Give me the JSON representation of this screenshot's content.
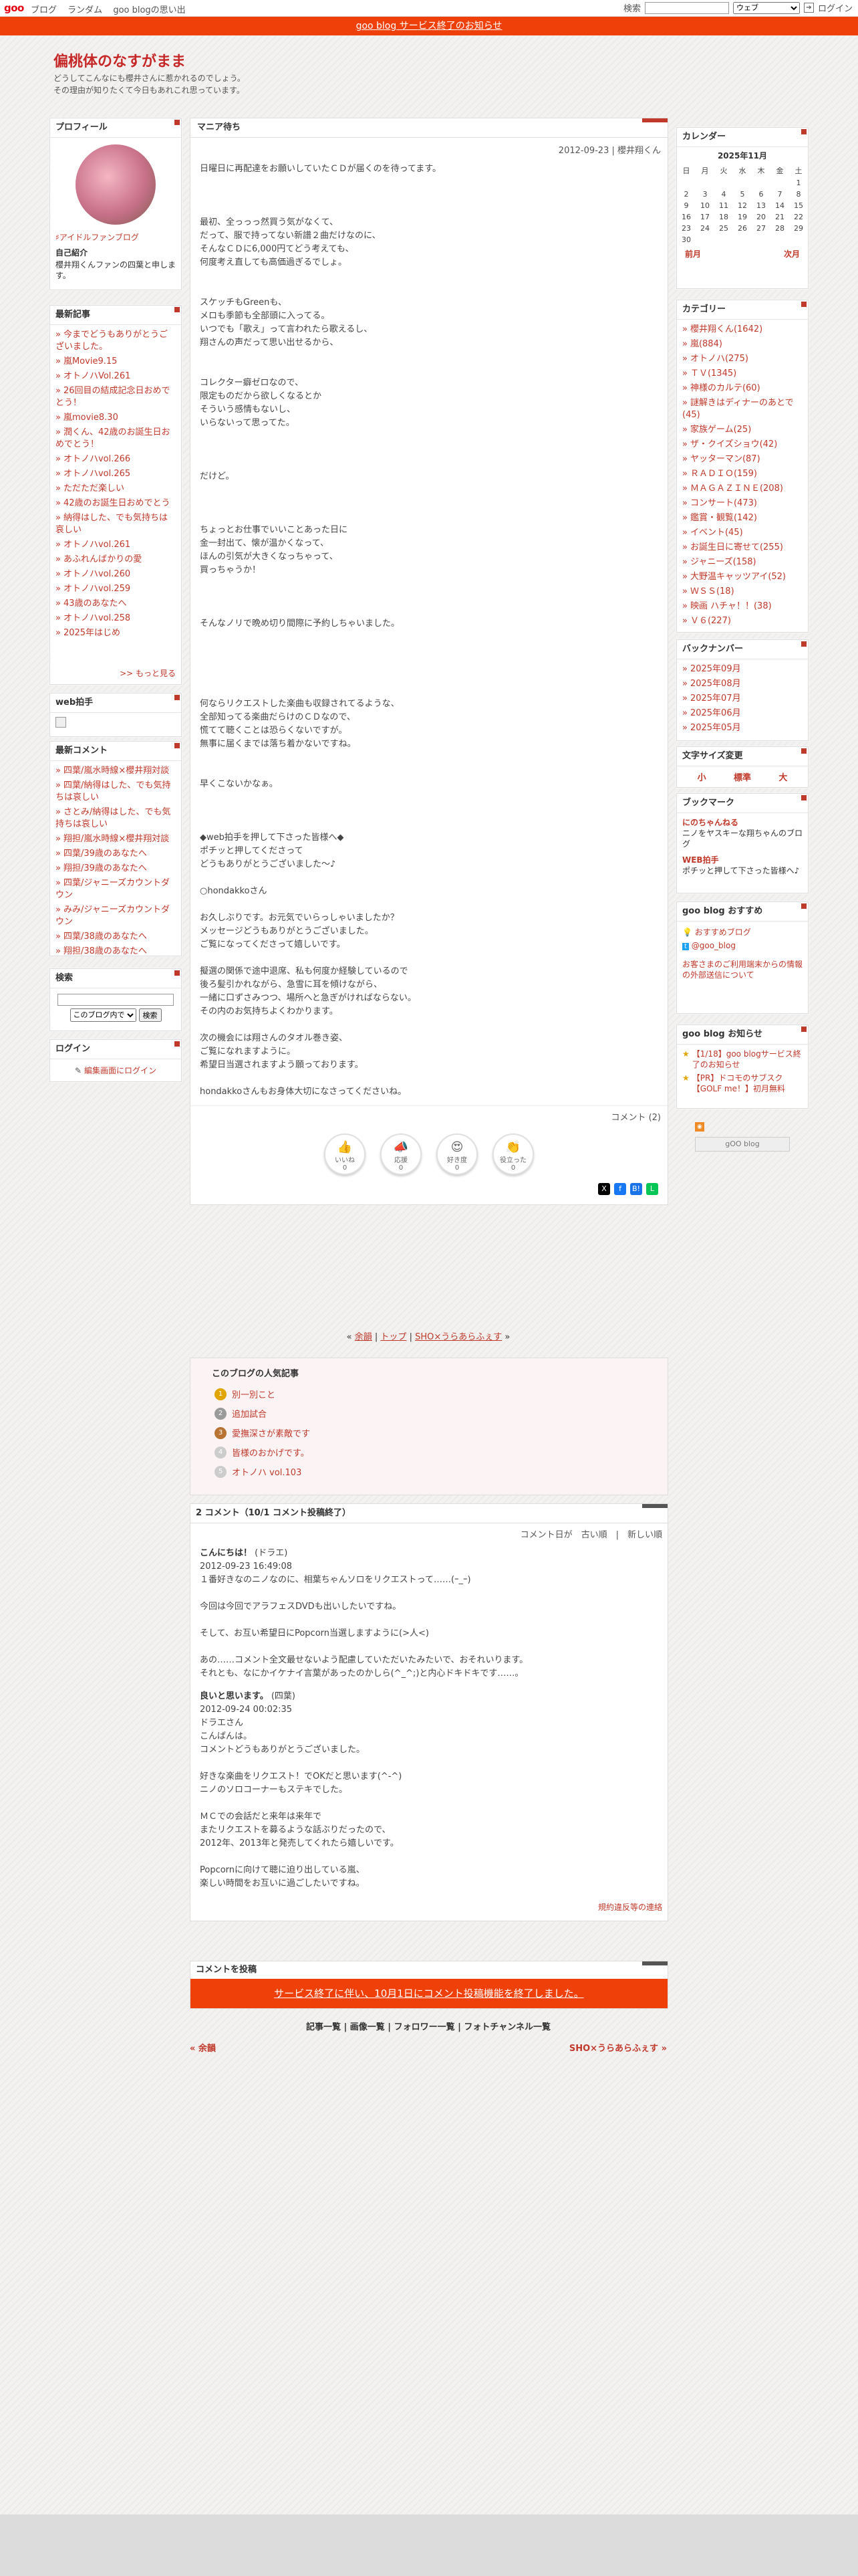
{
  "topbar": {
    "logo": "goo",
    "nav": [
      "ブログ",
      "ランダム",
      "goo blogの思い出"
    ],
    "search_label": "検索",
    "scope": "ウェブ",
    "login": "ログイン"
  },
  "notice": "goo blog サービス終了のお知らせ",
  "blog": {
    "title": "偏桃体のなすがまま",
    "desc1": "どうしてこんなにも櫻井さんに惹かれるのでしょう。",
    "desc2": "その理由が知りたくて今日もあれこれ思っています。"
  },
  "profile": {
    "heading": "プロフィール",
    "badge": "♯アイドルファンブログ",
    "intro_label": "自己紹介",
    "intro": "櫻井翔くんファンの四葉と申します。"
  },
  "recent": {
    "heading": "最新記事",
    "items": [
      "今までどうもありがとうございました。",
      "嵐Movie9.15",
      "オトノハVol.261",
      "26回目の結成記念日おめでとう！",
      "嵐movie8.30",
      "潤くん、42歳のお誕生日おめでとう！",
      "オトノハvol.266",
      "オトノハvol.265",
      "ただただ楽しい",
      "42歳のお誕生日おめでとう",
      "納得はした、でも気持ちは哀しい",
      "オトノハvol.261",
      "あふれんばかりの愛",
      "オトノハvol.260",
      "オトノハvol.259",
      "43歳のあなたへ",
      "オトノハvol.258",
      "2025年はじめ"
    ],
    "more": ">> もっと見る"
  },
  "webclap": {
    "heading": "web拍手"
  },
  "recent_comments": {
    "heading": "最新コメント",
    "items": [
      "四葉/嵐水時線×櫻井翔対談",
      "四葉/納得はした、でも気持ちは哀しい",
      "さとみ/納得はした、でも気持ちは哀しい",
      "翔担/嵐水時線×櫻井翔対談",
      "四葉/39歳のあなたへ",
      "翔担/39歳のあなたへ",
      "四葉/ジャニーズカウントダウン",
      "みみ/ジャニーズカウントダウン",
      "四葉/38歳のあなたへ",
      "翔担/38歳のあなたへ"
    ]
  },
  "search": {
    "heading": "検索",
    "scope": "このブログ内で",
    "button": "検索"
  },
  "login": {
    "heading": "ログイン",
    "link": "編集画面にログイン"
  },
  "post": {
    "title": "マニア待ち",
    "date": "2012-09-23 | 櫻井翔くん",
    "body": "日曜日に再配達をお願いしていたＣＤが届くのを待ってます。\n\n\n\n最初、全っっっ然買う気がなくて、\nだって、服で持ってない新譜２曲だけなのに、\nそんなＣＤに6,000円てどう考えても、\n何度考え直しても高価過ぎるでしょ。\n\n\nスケッチもGreenも、\nメロも季節も全部頭に入ってる。\nいつでも「歌え」って言われたら歌えるし、\n翔さんの声だって思い出せるから、\n\n\nコレクター癖ゼロなので、\n限定ものだから欲しくなるとか\nそういう感情もないし、\nいらないって思ってた。\n\n\n\nだけど。\n\n\n\nちょっとお仕事でいいことあった日に\n金一封出て、懐が温かくなって、\nほんの引気が大きくなっちゃって、\n買っちゃうか！\n\n\n\nそんなノリで晩め切り間際に予約しちゃいました。\n\n\n\n\n\n何ならリクエストした楽曲も収録されてるような、\n全部知ってる楽曲だらけのＣＤなので、\n慌てて聴くことは恐らくないですが。\n無事に届くまでは落ち着かないですね。\n\n\n早くこないかなぁ。\n\n\n\n◆web拍手を押して下さった皆様へ◆\nポチッと押してくださって\nどうもありがとうございました～♪\n\n○hondakkoさん\n\nお久しぶりです。お元気でいらっしゃいましたか？\nメッセージどうもありがとうございました。\nご覧になってくださって嬉しいです。\n\n擬選の関係で途中退席、私も何度か経験しているので\n後ろ髪引かれながら、急雪に耳を傾けながら、\n一緒に口ずさみつつ、場所へと急ぎがければならない。\nその内のお気持ちよくわかります。\n\n次の機会には翔さんのタオル巻き姿、\nご覧になれますように。\n希望日当選されますよう願っております。\n\nhondakkoさんもお身体大切になさってくださいね。",
    "comment_link": "コメント (2)",
    "reactions": [
      {
        "label": "いいね",
        "count": "0"
      },
      {
        "label": "応援",
        "count": "0"
      },
      {
        "label": "好き度",
        "count": "0"
      },
      {
        "label": "役立った",
        "count": "0"
      }
    ]
  },
  "pager": {
    "prev": "余韻",
    "top": "トップ",
    "next": "SHO×うらあらふぇす"
  },
  "popular": {
    "heading": "このブログの人気記事",
    "items": [
      "別一別こと",
      "追加試合",
      "愛撫深さが素敵です",
      "皆様のおかげです。",
      "オトノハ vol.103"
    ]
  },
  "comments": {
    "heading": "2 コメント（10/1 コメント投稿終了）",
    "filter": "コメント日が　古い順　|　新しい順",
    "entries": [
      {
        "name": "こんにちは！",
        "author": "(ドラエ)",
        "date": "2012-09-23 16:49:08",
        "text": "１番好きなのニノなのに、相葉ちゃんソロをリクエストって……(ｰ_ｰ)\n\n今回は今回でアラフェスDVDも出いしたいですね。\n\nそして、お互い希望日にPopcorn当選しますように(>人<)\n\nあの……コメント全文最せないよう配慮していただいたみたいで、おそれいります。\nそれとも、なにかイケナイ言葉があったのかしら(^_^;)と内心ドキドキです……。"
      },
      {
        "name": "良いと思います。",
        "author": "(四葉)",
        "date": "2012-09-24 00:02:35",
        "text": "ドラエさん\nこんばんは。\nコメントどうもありがとうございました。\n\n好きな楽曲をリクエスト！でOKだと思います(^-^)\nニノのソロコーナーもステキでした。\n\nＭＣでの会話だと来年は来年で\nまたリクエストを募るような話ぶりだったので、\n2012年、2013年と発売してくれたら嬉しいです。\n\nPopcornに向けて聴に迫り出している嵐、\n楽しい時間をお互いに過ごしたいですね。"
      }
    ],
    "policy": "規約違反等の連絡"
  },
  "post_comment": {
    "heading": "コメントを投稿",
    "ended": "サービス終了に伴い、10月1日にコメント投稿機能を終了しました。"
  },
  "footer_links": "記事一覧 | 画像一覧 | フォロワー一覧 | フォトチャンネル一覧",
  "footer_nav": {
    "prev": "« 余韻",
    "next": "SHO×うらあらふぇす »"
  },
  "calendar": {
    "heading": "カレンダー",
    "month": "2025年11月",
    "weekdays": [
      "日",
      "月",
      "火",
      "水",
      "木",
      "金",
      "土"
    ],
    "rows": [
      [
        "",
        "",
        "",
        "",
        "",
        "",
        "1"
      ],
      [
        "2",
        "3",
        "4",
        "5",
        "6",
        "7",
        "8"
      ],
      [
        "9",
        "10",
        "11",
        "12",
        "13",
        "14",
        "15"
      ],
      [
        "16",
        "17",
        "18",
        "19",
        "20",
        "21",
        "22"
      ],
      [
        "23",
        "24",
        "25",
        "26",
        "27",
        "28",
        "29"
      ],
      [
        "30",
        "",
        "",
        "",
        "",
        "",
        ""
      ]
    ],
    "prev": "前月",
    "next": "次月"
  },
  "categories": {
    "heading": "カテゴリー",
    "items": [
      "櫻井翔くん(1642)",
      "嵐(884)",
      "オトノハ(275)",
      "ＴＶ(1345)",
      "神様のカルテ(60)",
      "謎解きはディナーのあとで(45)",
      "家族ゲーム(25)",
      "ザ・クイズショウ(42)",
      "ヤッターマン(87)",
      "ＲＡＤＩＯ(159)",
      "ＭＡＧＡＺＩＮＥ(208)",
      "コンサート(473)",
      "鑑賞・観覧(142)",
      "イベント(45)",
      "お誕生日に寄せて(255)",
      "ジャニーズ(158)",
      "大野温キャッツアイ(52)",
      "ＷＳＳ(18)",
      "映画 ハチャ！！(38)",
      "Ｖ６(227)"
    ]
  },
  "backnumber": {
    "heading": "バックナンバー",
    "items": [
      "2025年09月",
      "2025年08月",
      "2025年07月",
      "2025年06月",
      "2025年05月"
    ]
  },
  "fontsize": {
    "heading": "文字サイズ変更",
    "small": "小",
    "mid": "標準",
    "large": "大"
  },
  "bookmark": {
    "heading": "ブックマーク",
    "items": [
      {
        "title": "にのちゃんねる",
        "desc": "ニノをヤスキーな翔ちゃんのブログ"
      },
      {
        "title": "WEB拍手",
        "desc": "ポチッと押して下さった皆様へ♪"
      }
    ]
  },
  "goo_recommend": {
    "heading": "goo blog おすすめ",
    "items": [
      "おすすめブログ",
      "@goo_blog"
    ],
    "notice": "お客さまのご利用端末からの情報の外部送信について"
  },
  "goo_notice": {
    "heading": "goo blog お知らせ",
    "items": [
      "【1/18】goo blogサービス終了のお知らせ",
      "【PR】ドコモのサブスク【GOLF me！】初月無料"
    ]
  },
  "footer_logo": "gOO blog",
  "colors": {
    "accent": "#c0392b",
    "orange": "#f0400a"
  }
}
